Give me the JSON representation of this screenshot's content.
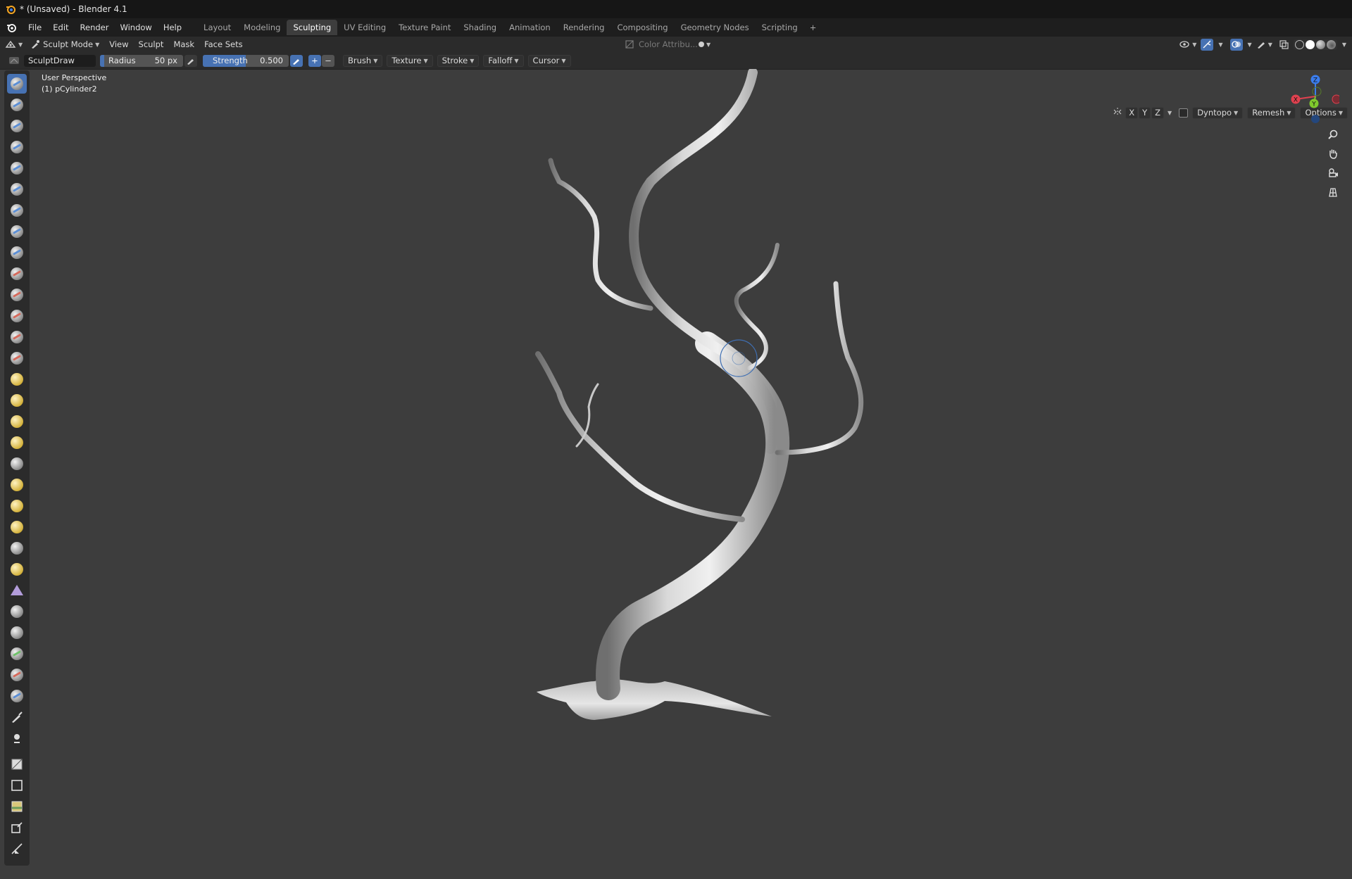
{
  "title_bar": {
    "title": "* (Unsaved) - Blender 4.1"
  },
  "menu": {
    "items": [
      "File",
      "Edit",
      "Render",
      "Window",
      "Help"
    ],
    "workspaces": [
      "Layout",
      "Modeling",
      "Sculpting",
      "UV Editing",
      "Texture Paint",
      "Shading",
      "Animation",
      "Rendering",
      "Compositing",
      "Geometry Nodes",
      "Scripting"
    ],
    "active_workspace": "Sculpting",
    "add_label": "+"
  },
  "header": {
    "mode": "Sculpt Mode",
    "menus": [
      "View",
      "Sculpt",
      "Mask",
      "Face Sets"
    ],
    "color_attribute": "Color Attribu..."
  },
  "tool_settings": {
    "brush_name": "SculptDraw",
    "radius_label": "Radius",
    "radius_value": "50 px",
    "strength_label": "Strength",
    "strength_value": "0.500",
    "strength_fraction": 0.5,
    "plus": "+",
    "minus": "−",
    "dropdowns": [
      "Brush",
      "Texture",
      "Stroke",
      "Falloff",
      "Cursor"
    ],
    "axes": [
      "X",
      "Y",
      "Z"
    ],
    "right_dropdowns": [
      "Dyntopo",
      "Remesh",
      "Options"
    ]
  },
  "viewport": {
    "view_name": "User Perspective",
    "object_name": "(1) pCylinder2",
    "gizmo": {
      "x": "X",
      "y": "Y",
      "z": "Z"
    },
    "colors": {
      "x": "#e0414f",
      "y": "#7fc92d",
      "z": "#3b7ded",
      "active": "#4772b3"
    }
  }
}
